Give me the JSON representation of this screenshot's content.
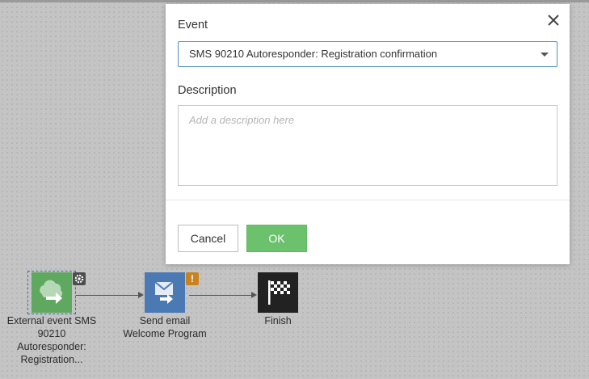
{
  "modal": {
    "event_label": "Event",
    "event_selected": "SMS 90210 Autoresponder: Registration confirmation",
    "description_label": "Description",
    "description_placeholder": "Add a description here",
    "cancel_label": "Cancel",
    "ok_label": "OK",
    "close_icon": "close-icon"
  },
  "workflow": {
    "nodes": [
      {
        "label_lines": [
          "External event SMS",
          "90210",
          "Autoresponder:",
          "Registration..."
        ],
        "icon": "cloud-arrow-icon",
        "badge": "gear-icon",
        "color": "#5fa85f"
      },
      {
        "label_lines": [
          "Send email",
          "Welcome Program"
        ],
        "icon": "envelope-arrow-icon",
        "badge": "warning-icon",
        "badge_text": "!",
        "color": "#4a79b3"
      },
      {
        "label_lines": [
          "Finish"
        ],
        "icon": "checkered-flag-icon",
        "color": "#222222"
      }
    ]
  },
  "colors": {
    "ok_button": "#6cc16c",
    "select_border": "#4f8ec9"
  }
}
